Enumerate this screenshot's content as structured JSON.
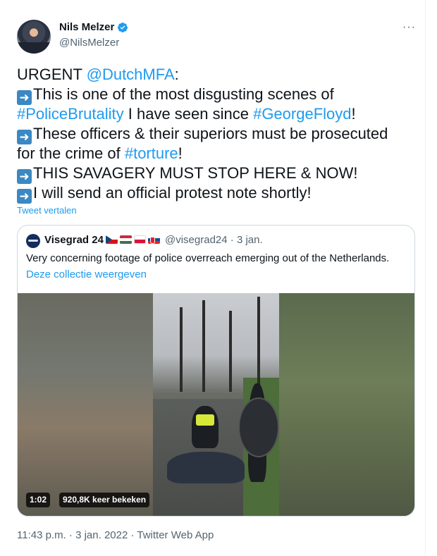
{
  "author": {
    "name": "Nils Melzer",
    "handle": "@NilsMelzer",
    "verified": true,
    "more_icon": "···"
  },
  "tweet": {
    "lines": [
      [
        {
          "t": "URGENT "
        },
        {
          "t": "@DutchMFA",
          "link": true
        },
        {
          "t": ":"
        }
      ],
      [
        {
          "arrow": true
        },
        {
          "t": "This is one of the most disgusting scenes of"
        }
      ],
      [
        {
          "t": "#PoliceBrutality",
          "link": true
        },
        {
          "t": " I have seen since "
        },
        {
          "t": "#GeorgeFloyd",
          "link": true
        },
        {
          "t": "!"
        }
      ],
      [
        {
          "arrow": true
        },
        {
          "t": "These officers & their superiors must be prosecuted"
        }
      ],
      [
        {
          "t": "for the crime of "
        },
        {
          "t": "#torture",
          "link": true
        },
        {
          "t": "!"
        }
      ],
      [
        {
          "arrow": true
        },
        {
          "t": "THIS SAVAGERY MUST STOP HERE & NOW!"
        }
      ],
      [
        {
          "arrow": true
        },
        {
          "t": "I will send an official protest note shortly!"
        }
      ]
    ],
    "arrow_glyph": "➜",
    "translate_label": "Tweet vertalen"
  },
  "quoted": {
    "name": "Visegrad 24",
    "flags": [
      "czech-flag",
      "hungary-flag",
      "poland-flag",
      "slovakia-flag"
    ],
    "handle_time": "@visegrad24 · 3 jan.",
    "text": "Very concerning footage of police overreach emerging out of the Netherlands.",
    "collection_link": "Deze collectie weergeven",
    "media": {
      "duration": "1:02",
      "views": "920,8K keer bekeken"
    }
  },
  "meta": {
    "timestamp": "11:43 p.m. · 3 jan. 2022 · Twitter Web App"
  },
  "colors": {
    "link": "#1d9bf0",
    "secondary_text": "#536471",
    "border": "#cfd9de",
    "arrow_emoji_bg": "#3b88c3"
  }
}
